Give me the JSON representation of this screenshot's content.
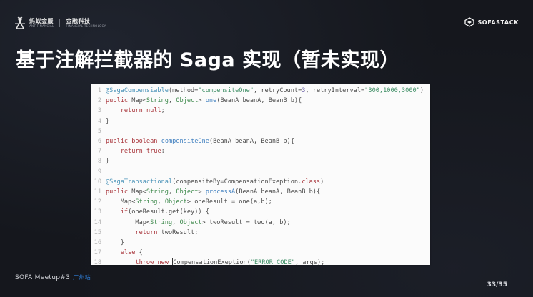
{
  "header": {
    "brand_cn": "蚂蚁金服",
    "brand_en": "ANT FINANCIAL",
    "brand_fin_cn": "金融科技",
    "brand_fin_en": "FINANCIAL TECHNOLOGY",
    "right_logo_text": "SOFASTACK"
  },
  "slide": {
    "title": "基于注解拦截器的 Saga 实现（暂未实现）"
  },
  "code": {
    "lines": [
      {
        "n": "1",
        "segments": [
          [
            "ann",
            "@SagaCompensiable"
          ],
          [
            "plain",
            "(method="
          ],
          [
            "str",
            "\"compensiteOne\""
          ],
          [
            "plain",
            ", retryCount="
          ],
          [
            "num",
            "3"
          ],
          [
            "plain",
            ", retryInterval="
          ],
          [
            "str",
            "\"300,1000,3000\""
          ],
          [
            "plain",
            ")"
          ]
        ]
      },
      {
        "n": "2",
        "segments": [
          [
            "kw",
            "public"
          ],
          [
            "plain",
            " Map<"
          ],
          [
            "type",
            "String"
          ],
          [
            "plain",
            ", "
          ],
          [
            "type",
            "Object"
          ],
          [
            "plain",
            "> "
          ],
          [
            "fn",
            "one"
          ],
          [
            "plain",
            "(BeanA beanA, BeanB b){"
          ]
        ]
      },
      {
        "n": "3",
        "segments": [
          [
            "plain",
            "    "
          ],
          [
            "kw",
            "return"
          ],
          [
            "plain",
            " "
          ],
          [
            "kw",
            "null"
          ],
          [
            "plain",
            ";"
          ]
        ]
      },
      {
        "n": "4",
        "segments": [
          [
            "plain",
            "}"
          ]
        ]
      },
      {
        "n": "5",
        "segments": []
      },
      {
        "n": "6",
        "segments": [
          [
            "kw",
            "public"
          ],
          [
            "plain",
            " "
          ],
          [
            "kw",
            "boolean"
          ],
          [
            "plain",
            " "
          ],
          [
            "fn",
            "compensiteOne"
          ],
          [
            "plain",
            "(BeanA beanA, BeanB b){"
          ]
        ]
      },
      {
        "n": "7",
        "segments": [
          [
            "plain",
            "    "
          ],
          [
            "kw",
            "return"
          ],
          [
            "plain",
            " "
          ],
          [
            "kw",
            "true"
          ],
          [
            "plain",
            ";"
          ]
        ]
      },
      {
        "n": "8",
        "segments": [
          [
            "plain",
            "}"
          ]
        ]
      },
      {
        "n": "9",
        "segments": []
      },
      {
        "n": "10",
        "segments": [
          [
            "ann",
            "@SagaTransactional"
          ],
          [
            "plain",
            "(compensiteBy=CompensationExeption."
          ],
          [
            "kw",
            "class"
          ],
          [
            "plain",
            ")"
          ]
        ]
      },
      {
        "n": "11",
        "segments": [
          [
            "kw",
            "public"
          ],
          [
            "plain",
            " Map<"
          ],
          [
            "type",
            "String"
          ],
          [
            "plain",
            ", "
          ],
          [
            "type",
            "Object"
          ],
          [
            "plain",
            "> "
          ],
          [
            "fn",
            "processA"
          ],
          [
            "plain",
            "(BeanA beanA, BeanB b){"
          ]
        ]
      },
      {
        "n": "12",
        "segments": [
          [
            "plain",
            "    Map<"
          ],
          [
            "type",
            "String"
          ],
          [
            "plain",
            ", "
          ],
          [
            "type",
            "Object"
          ],
          [
            "plain",
            "> oneResult = one(a,b);"
          ]
        ]
      },
      {
        "n": "13",
        "segments": [
          [
            "plain",
            "    "
          ],
          [
            "kw",
            "if"
          ],
          [
            "plain",
            "(oneResult.get(key)) {"
          ]
        ]
      },
      {
        "n": "14",
        "segments": [
          [
            "plain",
            "        Map<"
          ],
          [
            "type",
            "String"
          ],
          [
            "plain",
            ", "
          ],
          [
            "type",
            "Object"
          ],
          [
            "plain",
            "> twoResult = two(a, b);"
          ]
        ]
      },
      {
        "n": "15",
        "segments": [
          [
            "plain",
            "        "
          ],
          [
            "kw",
            "return"
          ],
          [
            "plain",
            " twoResult;"
          ]
        ]
      },
      {
        "n": "16",
        "segments": [
          [
            "plain",
            "    }"
          ]
        ]
      },
      {
        "n": "17",
        "segments": [
          [
            "plain",
            "    "
          ],
          [
            "kw",
            "else"
          ],
          [
            "plain",
            " {"
          ]
        ]
      },
      {
        "n": "18",
        "segments": [
          [
            "plain",
            "        "
          ],
          [
            "kw",
            "throw"
          ],
          [
            "plain",
            " "
          ],
          [
            "kw",
            "new"
          ],
          [
            "plain",
            " "
          ],
          [
            "caret",
            ""
          ],
          [
            "plain",
            "CompensationExeption("
          ],
          [
            "str",
            "\"ERROR_CODE\""
          ],
          [
            "plain",
            ", args);"
          ]
        ]
      }
    ]
  },
  "footer": {
    "event": "SOFA Meetup#3",
    "city": "广州站",
    "page": "33/35"
  },
  "colors": {
    "background": "#15171d",
    "annotation": "#4a93b8",
    "keyword": "#a8343a",
    "type": "#3f8a4d",
    "function": "#3f7fbf",
    "string": "#3f8f66",
    "footer_city": "#2f7fd9"
  }
}
